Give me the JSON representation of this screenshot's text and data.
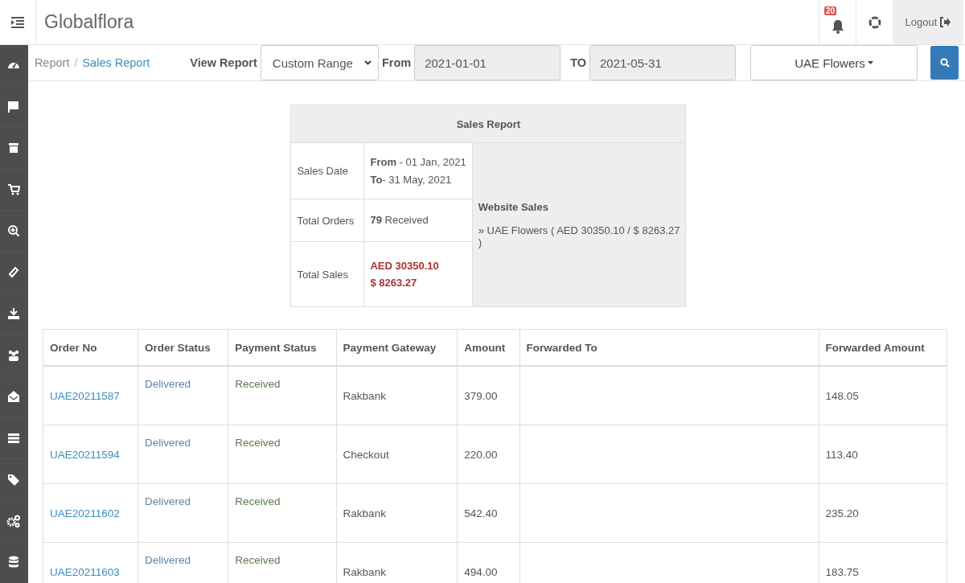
{
  "header": {
    "brand": "Globalflora",
    "notification_count": "20",
    "logout": "Logout"
  },
  "breadcrumb_separator": "/",
  "breadcrumb": [
    {
      "label": "Report",
      "selected": false
    },
    {
      "label": "Sales Report",
      "selected": true
    }
  ],
  "filters": {
    "view_report_label": "View Report",
    "range": "Custom Range",
    "from_label": "From",
    "from_value": "2021-01-01",
    "to_label": "TO",
    "to_value": "2021-05-31",
    "store": "UAE Flowers"
  },
  "summary": {
    "title": "Sales Report",
    "sales_date_label": "Sales Date",
    "sales_date_lines": [
      "**From** - 01 Jan, 2021",
      "**To**- 31 May, 2021"
    ],
    "total_orders_label": "Total Orders",
    "total_orders": "**79** Received",
    "total_sales_label": "Total Sales",
    "total_sales_lines": [
      "AED 30350.10",
      "$ 8263.27"
    ],
    "website_sales_title": "Website Sales",
    "website_sales_lines": [
      "» UAE Flowers ( AED 30350.10 / $ 8263.27 )"
    ]
  },
  "orders": {
    "columns": [
      "Order No",
      "Order Status",
      "Payment Status",
      "Payment Gateway",
      "Amount",
      "Forwarded To",
      "Forwarded Amount"
    ],
    "rows": [
      {
        "order_no": "UAE20211587",
        "order_status": "Delivered",
        "payment_status": "Received",
        "gateway": "Rakbank",
        "amount": "379.00",
        "forwarded_amount": "148.05"
      },
      {
        "order_no": "UAE20211594",
        "order_status": "Delivered",
        "payment_status": "Received",
        "gateway": "Checkout",
        "amount": "220.00",
        "forwarded_amount": "113.40"
      },
      {
        "order_no": "UAE20211602",
        "order_status": "Delivered",
        "payment_status": "Received",
        "gateway": "Rakbank",
        "amount": "542.40",
        "forwarded_amount": "235.20"
      },
      {
        "order_no": "UAE20211603",
        "order_status": "Delivered",
        "payment_status": "Received",
        "gateway": "Rakbank",
        "amount": "494.00",
        "forwarded_amount": "183.75"
      }
    ]
  }
}
